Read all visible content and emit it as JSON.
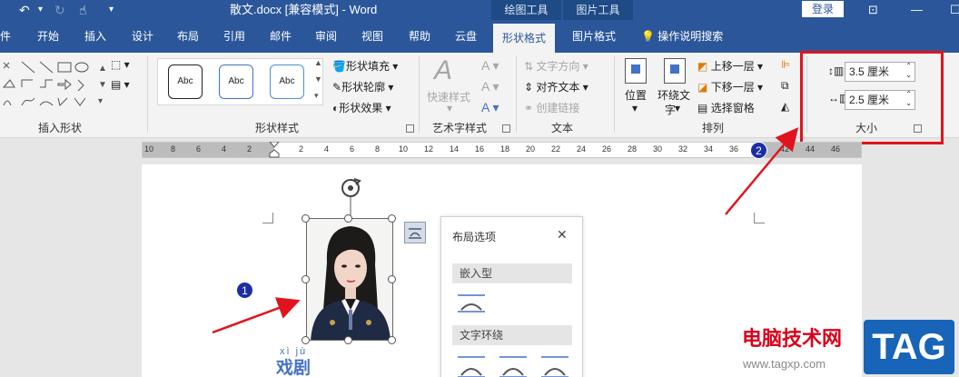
{
  "titlebar": {
    "doc_title": "散文.docx [兼容模式] - Word",
    "context_groups": [
      "绘图工具",
      "图片工具"
    ],
    "login_label": "登录"
  },
  "tabs": [
    "件",
    "开始",
    "插入",
    "设计",
    "布局",
    "引用",
    "邮件",
    "审阅",
    "视图",
    "帮助",
    "云盘",
    "形状格式",
    "图片格式"
  ],
  "active_tab": "形状格式",
  "tell_me": "操作说明搜索",
  "ribbon": {
    "insert_shapes": {
      "label": "插入形状"
    },
    "shape_styles": {
      "label": "形状样式",
      "preset_text": "Abc",
      "fill": "形状填充",
      "outline": "形状轮廓",
      "effects": "形状效果"
    },
    "wordart": {
      "label": "艺术字样式",
      "quick_styles": "快速样式"
    },
    "text": {
      "label": "文本",
      "direction": "文字方向",
      "align": "对齐文本",
      "link": "创建链接"
    },
    "arrange": {
      "label": "排列",
      "position": "位置",
      "wrap_line1": "环绕文",
      "wrap_line2": "字",
      "bring_forward": "上移一层",
      "send_backward": "下移一层",
      "selection_pane": "选择窗格"
    },
    "size": {
      "label": "大小",
      "height": "3.5 厘米",
      "width": "2.5 厘米"
    }
  },
  "ruler": {
    "ticks": [
      "10",
      "8",
      "6",
      "4",
      "2",
      "2",
      "4",
      "6",
      "8",
      "10",
      "12",
      "14",
      "16",
      "18",
      "20",
      "22",
      "24",
      "26",
      "28",
      "30",
      "32",
      "34",
      "36",
      "38",
      "42",
      "44",
      "46"
    ]
  },
  "layout_panel": {
    "title": "布局选项",
    "inline_section": "嵌入型",
    "wrap_section": "文字环绕"
  },
  "annotations": [
    "1",
    "2"
  ],
  "document": {
    "ruby": "xì jù",
    "heading": "戏剧"
  },
  "watermark": {
    "site": "电脑技术网",
    "url": "www.tagxp.com",
    "logo": "TAG"
  },
  "colors": {
    "word_blue": "#2b579a",
    "highlight_red": "#e0141e",
    "annotation_blue": "#1b2ea8"
  }
}
